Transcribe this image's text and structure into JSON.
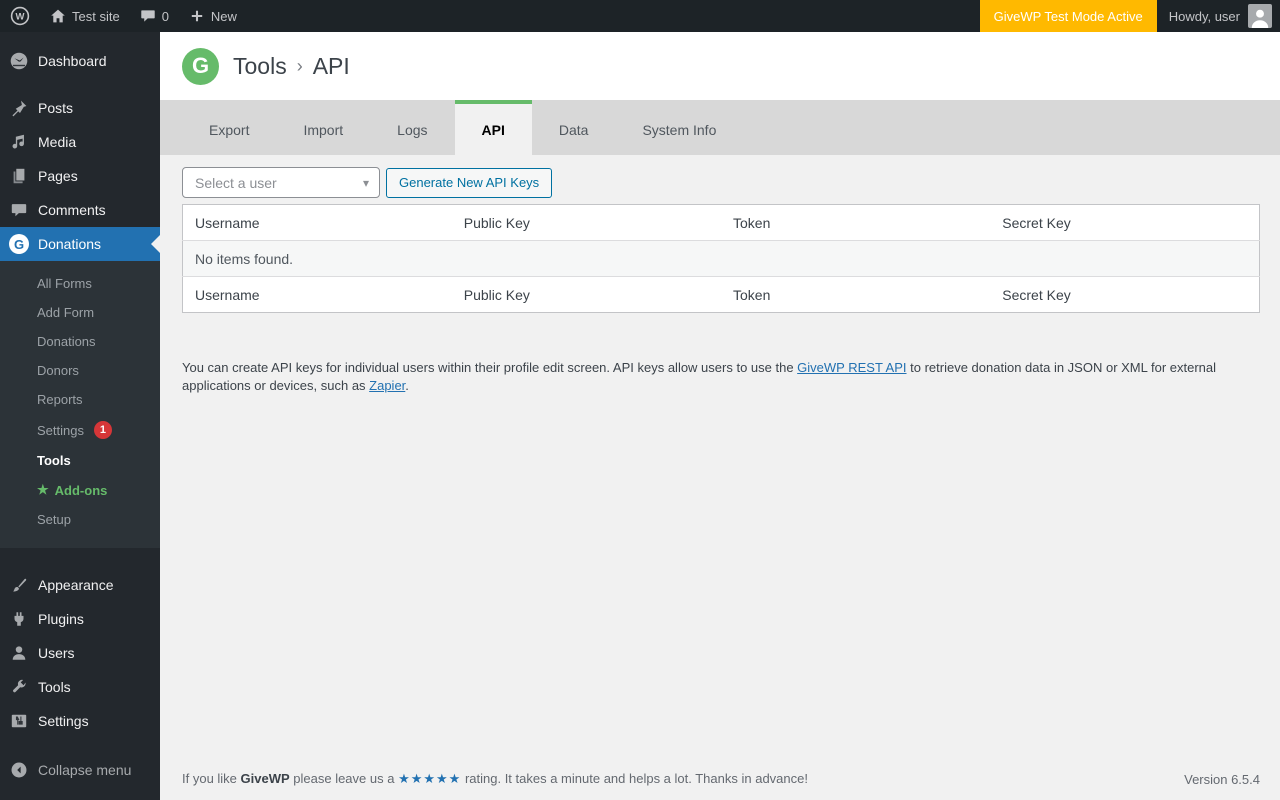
{
  "admin_bar": {
    "site_name": "Test site",
    "comments_count": "0",
    "new_label": "New",
    "test_mode_label": "GiveWP Test Mode Active",
    "howdy_text": "Howdy, user"
  },
  "sidebar": {
    "menu": [
      {
        "label": "Dashboard"
      },
      {
        "label": "Posts"
      },
      {
        "label": "Media"
      },
      {
        "label": "Pages"
      },
      {
        "label": "Comments"
      },
      {
        "label": "Donations"
      }
    ],
    "donations_submenu": [
      {
        "label": "All Forms"
      },
      {
        "label": "Add Form"
      },
      {
        "label": "Donations"
      },
      {
        "label": "Donors"
      },
      {
        "label": "Reports"
      },
      {
        "label": "Settings",
        "badge": "1"
      },
      {
        "label": "Tools"
      },
      {
        "label": "Add-ons"
      },
      {
        "label": "Setup"
      }
    ],
    "lower_menu": [
      {
        "label": "Appearance"
      },
      {
        "label": "Plugins"
      },
      {
        "label": "Users"
      },
      {
        "label": "Tools"
      },
      {
        "label": "Settings"
      }
    ],
    "collapse_label": "Collapse menu"
  },
  "header": {
    "breadcrumb_root": "Tools",
    "separator": "›",
    "breadcrumb_current": "API"
  },
  "tabs": {
    "items": [
      {
        "label": "Export"
      },
      {
        "label": "Import"
      },
      {
        "label": "Logs"
      },
      {
        "label": "API"
      },
      {
        "label": "Data"
      },
      {
        "label": "System Info"
      }
    ],
    "active": "API"
  },
  "api_section": {
    "user_select_placeholder": "Select a user",
    "generate_button_label": "Generate New API Keys",
    "table": {
      "columns": [
        "Username",
        "Public Key",
        "Token",
        "Secret Key"
      ],
      "empty_message": "No items found."
    },
    "description": {
      "text_1": "You can create API keys for individual users within their profile edit screen. API keys allow users to use the ",
      "link_1": "GiveWP REST API",
      "text_2": " to retrieve donation data in JSON or XML for external applications or devices, such as ",
      "link_2": "Zapier",
      "text_3": "."
    }
  },
  "footer": {
    "text_1": "If you like ",
    "brand": "GiveWP",
    "text_2": " please leave us a ",
    "stars": "★★★★★",
    "text_3": " rating. It takes a minute and helps a lot. Thanks in advance!",
    "version": "Version 6.5.4"
  },
  "icons": {
    "givewp_glyph": "G",
    "addon_star": "★",
    "dropdown_arrow": "▾"
  },
  "colors": {
    "brand_green": "#66bb6a",
    "active_menu_blue": "#2271b1",
    "test_mode_orange": "#ffb900",
    "badge_red": "#d63638",
    "link_blue": "#2271b1",
    "button_blue": "#0071a1",
    "adminbar_bg": "#1d2327",
    "sidebar_bg": "#23282d",
    "submenu_bg": "#2c3338",
    "content_bg": "#f1f1f1",
    "tabbar_bg": "#d8d8d8"
  }
}
